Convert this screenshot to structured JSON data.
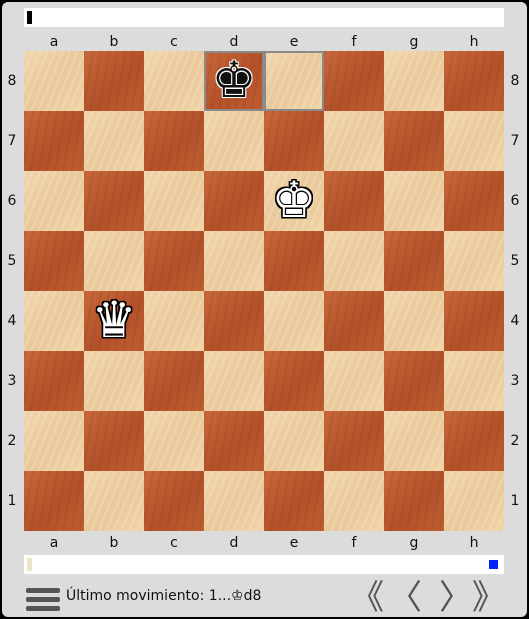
{
  "files": [
    "a",
    "b",
    "c",
    "d",
    "e",
    "f",
    "g",
    "h"
  ],
  "ranks": [
    "8",
    "7",
    "6",
    "5",
    "4",
    "3",
    "2",
    "1"
  ],
  "pieces": [
    {
      "square": "d8",
      "glyph": "♚",
      "color": "black",
      "name": "black-king-icon"
    },
    {
      "square": "e6",
      "glyph": "♚",
      "color": "white",
      "name": "white-king-icon"
    },
    {
      "square": "b4",
      "glyph": "♛",
      "color": "white",
      "name": "white-queen-icon"
    }
  ],
  "highlighted_squares": [
    "d8",
    "e8"
  ],
  "colors": {
    "light_square": "#f1d6ac",
    "dark_square": "#b4512a",
    "highlight": "#8a8a8a",
    "progress_end": "#0022ff"
  },
  "status": {
    "text": "Último movimiento: 1...♔d8"
  },
  "nav": {
    "first": "《",
    "prev": "〈",
    "next": "〉",
    "last": "》"
  },
  "icons": {
    "menu": "hamburger-menu-icon"
  }
}
